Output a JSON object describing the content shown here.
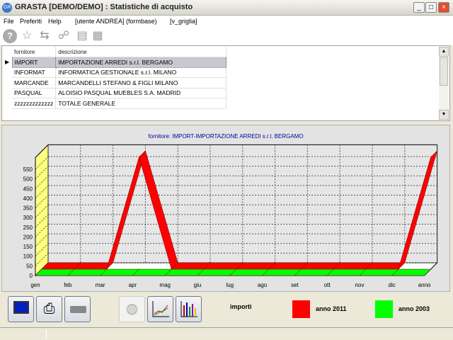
{
  "window": {
    "title": "GRASTA [DEMO/DEMO] : Statistiche di acquisto",
    "app_icon": "gr-icon"
  },
  "menu": {
    "items": [
      "File",
      "Preferiti",
      "Help"
    ],
    "user_info": "[utente ANDREA] (formbase)",
    "view_info": "[v_griglia]"
  },
  "toolbar": {
    "icons": [
      "help-icon",
      "star-icon",
      "exchange-icon",
      "binoculars-icon",
      "document-icon",
      "form-icon"
    ]
  },
  "grid": {
    "columns": [
      "fornitore",
      "descrizione"
    ],
    "rows": [
      {
        "fornitore": "IMPORT",
        "descrizione": "IMPORTAZIONE ARREDI s.r.l. BERGAMO",
        "selected": true
      },
      {
        "fornitore": "INFORMAT",
        "descrizione": "INFORMATICA GESTIONALE s.r.l. MILANO"
      },
      {
        "fornitore": "MARCANDE",
        "descrizione": "MARCANDELLI STEFANO & FIGLI MILANO"
      },
      {
        "fornitore": "PASQUAL",
        "descrizione": "ALOISIO PASQUAL MUEBLES S.A. MADRID"
      },
      {
        "fornitore": "zzzzzzzzzzzzz",
        "descrizione": "TOTALE GENERALE"
      }
    ]
  },
  "chart_data": {
    "type": "line",
    "style": "3d-ribbon",
    "title": "fornitore: IMPORT-IMPORTAZIONE ARREDI s.r.l. BERGAMO",
    "categories": [
      "gen",
      "feb",
      "mar",
      "apr",
      "mag",
      "giu",
      "lug",
      "ago",
      "set",
      "ott",
      "nov",
      "dic",
      "anno"
    ],
    "yticks": [
      0,
      50,
      100,
      150,
      200,
      250,
      300,
      350,
      400,
      450,
      500,
      550
    ],
    "ylim": [
      0,
      600
    ],
    "grid": true,
    "legend_title": "importi",
    "series": [
      {
        "name": "anno 2011",
        "color": "#ff0000",
        "values": [
          0,
          0,
          0,
          580,
          0,
          0,
          0,
          0,
          0,
          0,
          0,
          0,
          580
        ]
      },
      {
        "name": "anno 2003",
        "color": "#00ff00",
        "values": [
          0,
          0,
          0,
          0,
          0,
          0,
          0,
          0,
          0,
          0,
          0,
          0,
          0
        ]
      }
    ],
    "legend": "bottom-right"
  },
  "bottom": {
    "buttons": [
      "screen-icon",
      "printer-icon",
      "export-icon",
      "pie-chart-icon",
      "line-chart-icon",
      "bar-chart-icon"
    ]
  }
}
